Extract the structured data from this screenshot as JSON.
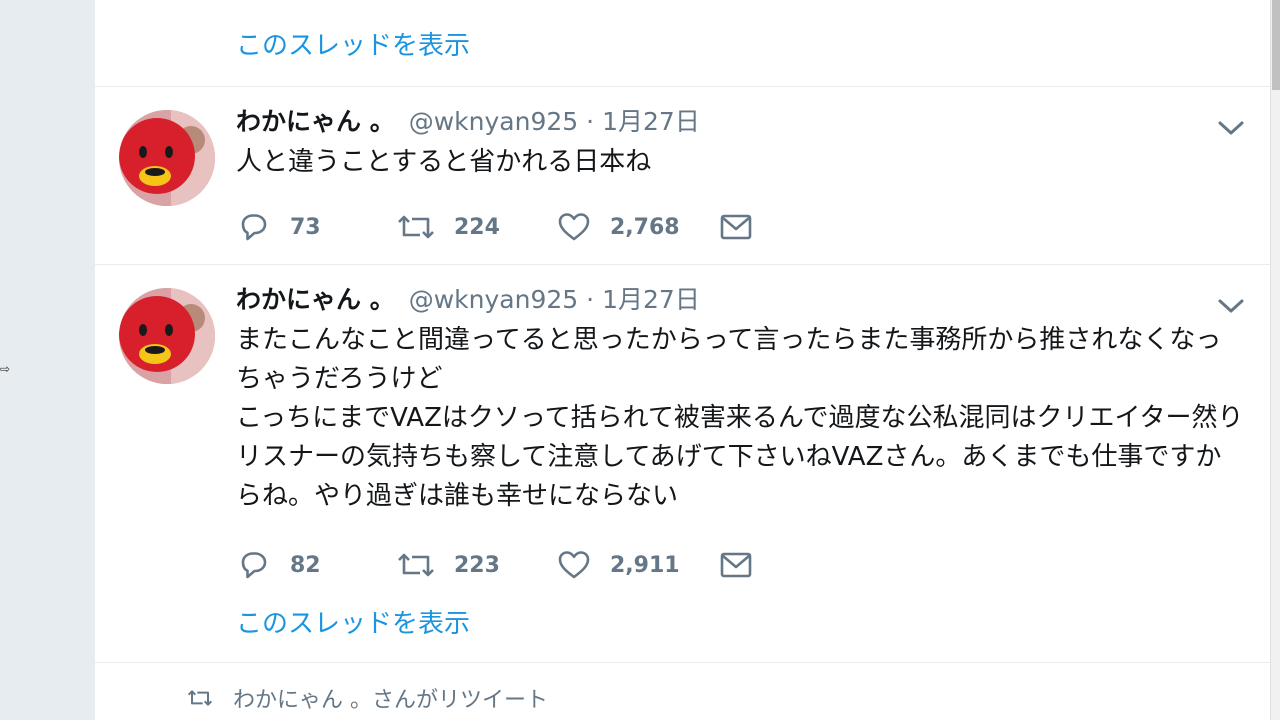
{
  "top": {
    "show_thread": "このスレッドを表示"
  },
  "tweets": [
    {
      "name": "わかにゃん 。",
      "handle": "@wknyan925",
      "separator": "·",
      "time": "1月27日",
      "text": "人と違うことすると省かれる日本ね",
      "replies": "73",
      "retweets": "224",
      "likes": "2,768"
    },
    {
      "name": "わかにゃん 。",
      "handle": "@wknyan925",
      "separator": "·",
      "time": "1月27日",
      "text": "またこんなこと間違ってると思ったからって言ったらまた事務所から推されなくなっちゃうだろうけど\nこっちにまでVAZはクソって括られて被害来るんで過度な公私混同はクリエイター然りリスナーの気持ちも察して注意してあげて下さいねVAZさん。あくまでも仕事ですからね。やり過ぎは誰も幸せにならない",
      "replies": "82",
      "retweets": "223",
      "likes": "2,911",
      "show_thread": "このスレッドを表示"
    }
  ],
  "retweet_banner": {
    "text": "わかにゃん 。さんがリツイート"
  },
  "icons": {
    "reply": "reply-icon",
    "retweet": "retweet-icon",
    "like": "heart-icon",
    "dm": "envelope-icon",
    "caret": "chevron-down-icon"
  },
  "colors": {
    "link": "#1b95e0",
    "text": "#14171a",
    "secondary": "#657786",
    "background": "#e6ecf0"
  }
}
